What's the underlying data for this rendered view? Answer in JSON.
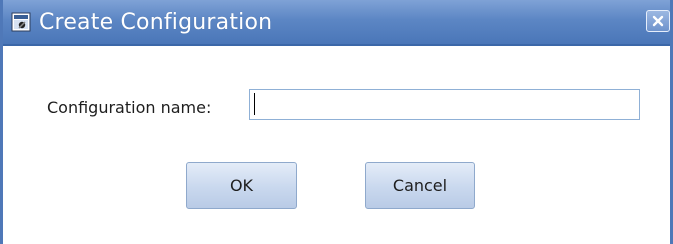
{
  "dialog": {
    "title": "Create Configuration",
    "title_icon": "configuration-window-icon",
    "close_icon": "close-icon"
  },
  "form": {
    "label": "Configuration name:",
    "value": "",
    "placeholder": ""
  },
  "buttons": {
    "ok_label": "OK",
    "cancel_label": "Cancel"
  },
  "colors": {
    "titlebar": "#5c86c4",
    "border": "#4f78b8",
    "button": "#c9d8ee"
  }
}
